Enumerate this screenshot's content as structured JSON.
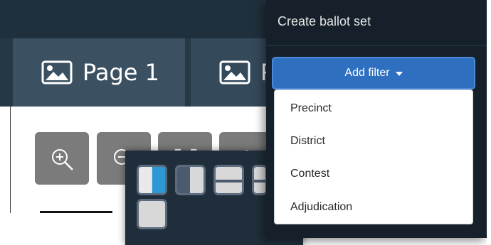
{
  "tabs": [
    {
      "label": "Page 1",
      "icon": "image-icon"
    },
    {
      "label": "P",
      "icon": "image-icon"
    }
  ],
  "toolbar": {
    "buttons": [
      {
        "name": "zoom-in",
        "icon": "zoom-in-icon"
      },
      {
        "name": "zoom-out",
        "icon": "zoom-out-icon"
      },
      {
        "name": "fit",
        "icon": "fit-icon"
      },
      {
        "name": "layout",
        "icon": "layout-icon"
      }
    ]
  },
  "layout_options": [
    {
      "name": "split-left-blue"
    },
    {
      "name": "split-left-dark"
    },
    {
      "name": "split-top"
    },
    {
      "name": "split-top-partial"
    },
    {
      "name": "single"
    }
  ],
  "panel": {
    "title": "Create ballot set",
    "filter_button": "Add filter",
    "filter_options": [
      "Precinct",
      "District",
      "Contest",
      "Adjudication"
    ]
  },
  "colors": {
    "accent": "#2e6fbf",
    "panel_bg": "#15202a",
    "tab_active": "#3b5161"
  }
}
